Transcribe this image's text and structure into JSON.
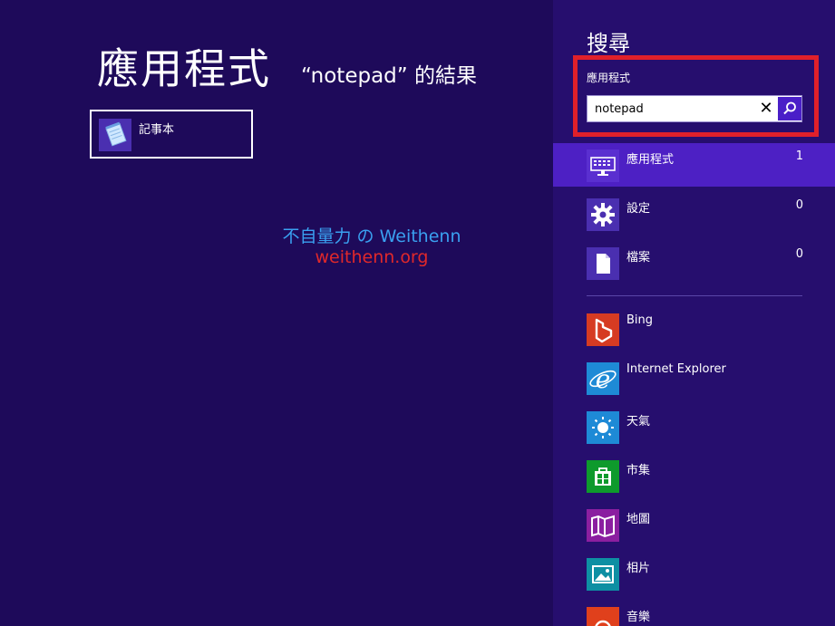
{
  "results": {
    "title": "應用程式",
    "subtitle": "“notepad” 的結果",
    "items": [
      {
        "label": "記事本",
        "icon": "notepad-icon"
      }
    ]
  },
  "watermark": {
    "line1": "不自量力 の Weithenn",
    "line2": "weithenn.org"
  },
  "charm": {
    "title": "搜尋",
    "scope_label": "應用程式",
    "search": {
      "value": "notepad",
      "placeholder": ""
    },
    "categories": [
      {
        "label": "應用程式",
        "count": "1",
        "icon": "keyboard-icon",
        "active": true
      },
      {
        "label": "設定",
        "count": "0",
        "icon": "gear-icon",
        "active": false
      },
      {
        "label": "檔案",
        "count": "0",
        "icon": "file-icon",
        "active": false
      }
    ],
    "apps": [
      {
        "label": "Bing",
        "icon": "bing-icon",
        "color": "#d63b22"
      },
      {
        "label": "Internet Explorer",
        "icon": "ie-icon",
        "color": "#1e8ad6"
      },
      {
        "label": "天氣",
        "icon": "weather-icon",
        "color": "#1e8ad6"
      },
      {
        "label": "市集",
        "icon": "store-icon",
        "color": "#0e9a2c"
      },
      {
        "label": "地圖",
        "icon": "map-icon",
        "color": "#8b1fa0"
      },
      {
        "label": "相片",
        "icon": "photos-icon",
        "color": "#0e8fa3"
      },
      {
        "label": "音樂",
        "icon": "music-icon",
        "color": "#e0401c"
      }
    ]
  },
  "colors": {
    "background": "#1e0a5a",
    "charm_background": "#260e6e",
    "active_item": "#4d20c4",
    "highlight_border": "#e0202a"
  }
}
